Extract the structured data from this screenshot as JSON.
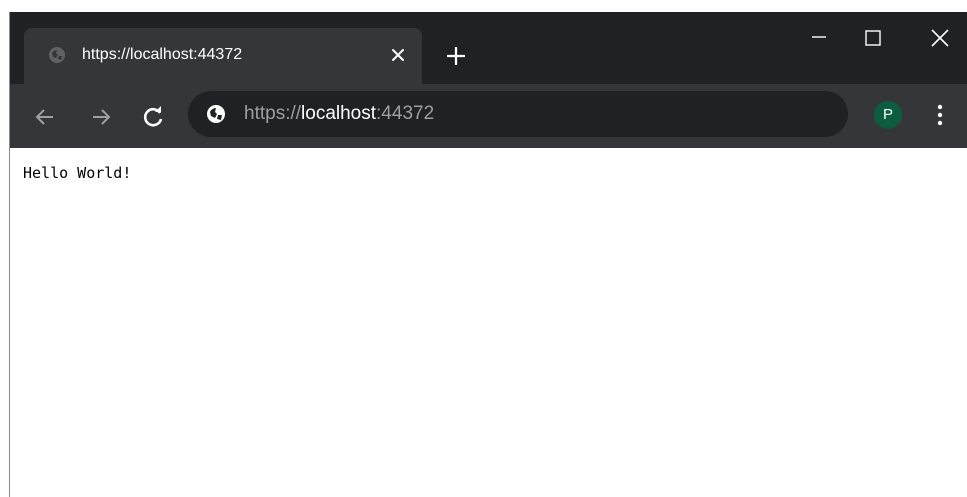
{
  "tab": {
    "title": "https://localhost:44372",
    "favicon": "globe-icon"
  },
  "window_controls": {
    "minimize": "minimize-icon",
    "maximize": "maximize-icon",
    "close": "close-icon"
  },
  "address_bar": {
    "scheme": "https://",
    "host": "localhost",
    "port": ":44372",
    "security_icon": "globe-icon"
  },
  "profile": {
    "initial": "P",
    "color": "#0b5d3f"
  },
  "page": {
    "body_text": "Hello World!"
  },
  "colors": {
    "titlebar": "#202124",
    "toolbar": "#35363a",
    "omnibox": "#202124"
  }
}
